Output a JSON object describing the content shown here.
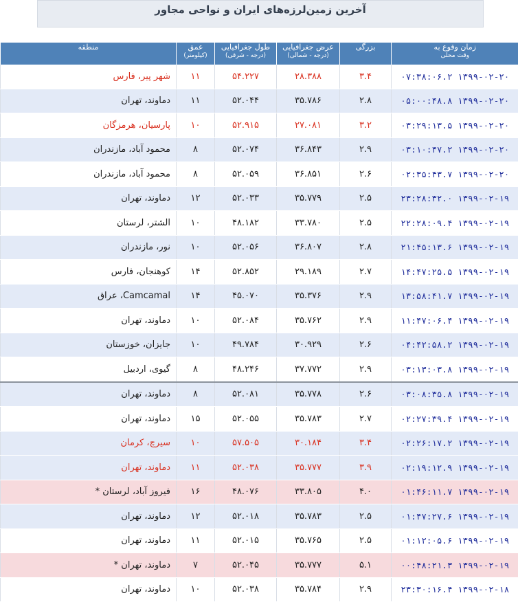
{
  "page": {
    "title": "آخرین زمین‌لرزه‌های ایران و نواحی مجاور"
  },
  "columns": {
    "time": "زمان وقوع به",
    "time_sub": "وقت محلی",
    "magnitude": "بزرگی",
    "latitude": "عرض جغرافیایی",
    "latitude_sub": "(درجه - شمالی)",
    "longitude": "طول جغرافیایی",
    "longitude_sub": "(درجه - شرقی)",
    "depth": "عمق",
    "depth_sub": "(کیلومتر)",
    "region": "منطقه"
  },
  "rows": [
    {
      "time": "۱۳۹۹-۰۲-۲۰ ۰۷:۳۸:۰۶.۲",
      "mag": "۳.۴",
      "lat": "۲۸.۳۸۸",
      "lon": "۵۴.۲۲۷",
      "depth": "۱۱",
      "region": "شهر پیر، فارس"
    },
    {
      "time": "۱۳۹۹-۰۲-۲۰ ۰۵:۰۰:۴۸.۸",
      "mag": "۲.۸",
      "lat": "۳۵.۷۸۶",
      "lon": "۵۲.۰۴۴",
      "depth": "۱۱",
      "region": "دماوند، تهران"
    },
    {
      "time": "۱۳۹۹-۰۲-۲۰ ۰۳:۲۹:۱۳.۵",
      "mag": "۳.۲",
      "lat": "۲۷.۰۸۱",
      "lon": "۵۲.۹۱۵",
      "depth": "۱۰",
      "region": "پارسیان، هرمزگان"
    },
    {
      "time": "۱۳۹۹-۰۲-۲۰ ۰۳:۱۰:۴۷.۲",
      "mag": "۲.۹",
      "lat": "۳۶.۸۴۳",
      "lon": "۵۲.۰۷۴",
      "depth": "۸",
      "region": "محمود آباد، مازندران"
    },
    {
      "time": "۱۳۹۹-۰۲-۲۰ ۰۲:۳۵:۴۳.۷",
      "mag": "۲.۶",
      "lat": "۳۶.۸۵۱",
      "lon": "۵۲.۰۵۹",
      "depth": "۸",
      "region": "محمود آباد، مازندران"
    },
    {
      "time": "۱۳۹۹-۰۲-۱۹ ۲۳:۲۸:۳۲.۰",
      "mag": "۲.۵",
      "lat": "۳۵.۷۷۹",
      "lon": "۵۲.۰۳۳",
      "depth": "۱۲",
      "region": "دماوند، تهران"
    },
    {
      "time": "۱۳۹۹-۰۲-۱۹ ۲۲:۲۸:۰۹.۴",
      "mag": "۲.۵",
      "lat": "۳۳.۷۸۰",
      "lon": "۴۸.۱۸۲",
      "depth": "۱۰",
      "region": "الشتر، لرستان"
    },
    {
      "time": "۱۳۹۹-۰۲-۱۹ ۲۱:۴۵:۱۳.۶",
      "mag": "۲.۸",
      "lat": "۳۶.۸۰۷",
      "lon": "۵۲.۰۵۶",
      "depth": "۱۰",
      "region": "نور، مازندران"
    },
    {
      "time": "۱۳۹۹-۰۲-۱۹ ۱۴:۴۷:۲۵.۵",
      "mag": "۲.۷",
      "lat": "۲۹.۱۸۹",
      "lon": "۵۲.۸۵۲",
      "depth": "۱۴",
      "region": "کوهنجان، فارس"
    },
    {
      "time": "۱۳۹۹-۰۲-۱۹ ۱۳:۵۸:۴۱.۷",
      "mag": "۲.۹",
      "lat": "۳۵.۳۷۶",
      "lon": "۴۵.۰۷۰",
      "depth": "۱۴",
      "region": "Camcamal، عراق"
    },
    {
      "time": "۱۳۹۹-۰۲-۱۹ ۱۱:۴۷:۰۶.۴",
      "mag": "۲.۹",
      "lat": "۳۵.۷۶۲",
      "lon": "۵۲.۰۸۴",
      "depth": "۱۰",
      "region": "دماوند، تهران"
    },
    {
      "time": "۱۳۹۹-۰۲-۱۹ ۰۴:۴۲:۵۸.۲",
      "mag": "۲.۶",
      "lat": "۳۰.۹۲۹",
      "lon": "۴۹.۷۸۴",
      "depth": "۱۰",
      "region": "جایزان، خوزستان"
    },
    {
      "time": "۱۳۹۹-۰۲-۱۹ ۰۳:۱۳:۰۳.۸",
      "mag": "۲.۹",
      "lat": "۳۷.۷۷۲",
      "lon": "۴۸.۲۴۶",
      "depth": "۸",
      "region": "گیوی، اردبیل"
    },
    {
      "time": "۱۳۹۹-۰۲-۱۹ ۰۳:۰۸:۳۵.۸",
      "mag": "۲.۶",
      "lat": "۳۵.۷۷۸",
      "lon": "۵۲.۰۸۱",
      "depth": "۸",
      "region": "دماوند، تهران"
    },
    {
      "time": "۱۳۹۹-۰۲-۱۹ ۰۲:۲۷:۳۹.۴",
      "mag": "۲.۷",
      "lat": "۳۵.۷۸۳",
      "lon": "۵۲.۰۵۵",
      "depth": "۱۵",
      "region": "دماوند، تهران"
    },
    {
      "time": "۱۳۹۹-۰۲-۱۹ ۰۲:۲۶:۱۷.۲",
      "mag": "۳.۴",
      "lat": "۳۰.۱۸۴",
      "lon": "۵۷.۵۰۵",
      "depth": "۱۰",
      "region": "سیرچ، کرمان"
    },
    {
      "time": "۱۳۹۹-۰۲-۱۹ ۰۲:۱۹:۱۲.۹",
      "mag": "۳.۹",
      "lat": "۳۵.۷۷۷",
      "lon": "۵۲.۰۳۸",
      "depth": "۱۱",
      "region": "دماوند، تهران"
    },
    {
      "time": "۱۳۹۹-۰۲-۱۹ ۰۱:۴۶:۱۱.۷",
      "mag": "۴.۰",
      "lat": "۳۳.۸۰۵",
      "lon": "۴۸.۰۷۶",
      "depth": "۱۶",
      "region": "فیروز آباد، لرستان *"
    },
    {
      "time": "۱۳۹۹-۰۲-۱۹ ۰۱:۴۷:۲۷.۶",
      "mag": "۲.۵",
      "lat": "۳۵.۷۸۳",
      "lon": "۵۲.۰۱۸",
      "depth": "۱۲",
      "region": "دماوند، تهران"
    },
    {
      "time": "۱۳۹۹-۰۲-۱۹ ۰۱:۱۲:۰۵.۶",
      "mag": "۲.۵",
      "lat": "۳۵.۷۶۵",
      "lon": "۵۲.۰۱۵",
      "depth": "۱۱",
      "region": "دماوند، تهران"
    },
    {
      "time": "۱۳۹۹-۰۲-۱۹ ۰۰:۴۸:۲۱.۳",
      "mag": "۵.۱",
      "lat": "۳۵.۷۷۷",
      "lon": "۵۲.۰۴۵",
      "depth": "۷",
      "region": "دماوند، تهران *"
    },
    {
      "time": "۱۳۹۹-۰۲-۱۸ ۲۳:۳۰:۱۶.۴",
      "mag": "۲.۹",
      "lat": "۳۵.۷۸۴",
      "lon": "۵۲.۰۳۸",
      "depth": "۱۰",
      "region": "دماوند، تهران"
    }
  ]
}
